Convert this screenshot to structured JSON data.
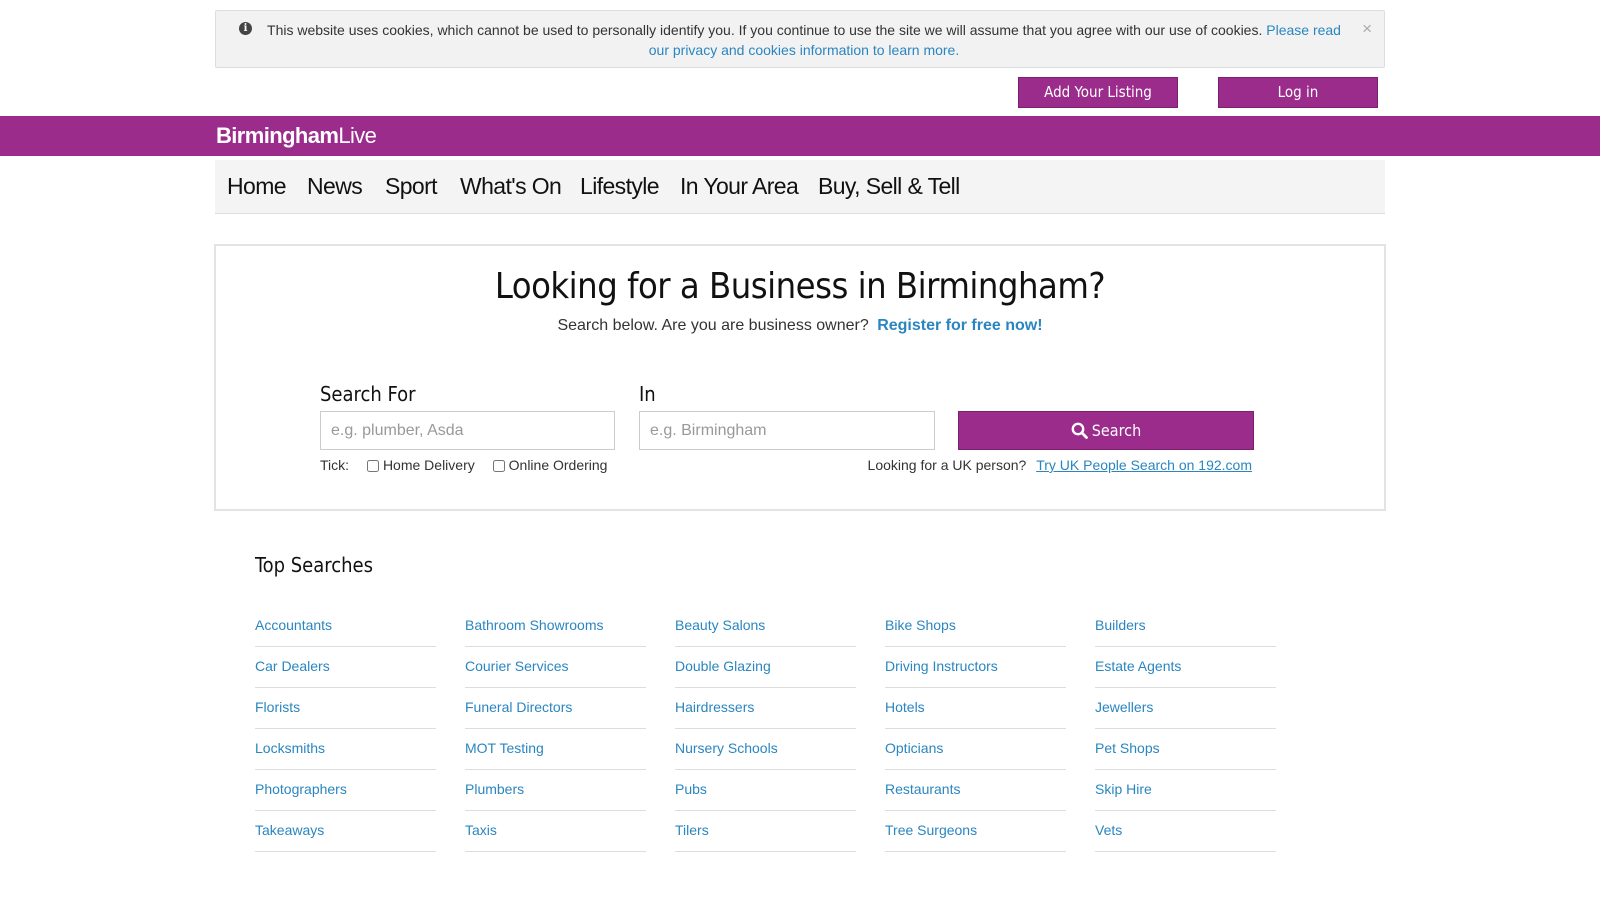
{
  "cookie_banner": {
    "message": "This website uses cookies, which cannot be used to personally identify you. If you continue to use the site we will assume that you agree with our use of cookies.",
    "link": "Please read our privacy and cookies information to learn more.",
    "close": "×"
  },
  "header": {
    "add_listing": "Add Your Listing",
    "login": "Log in"
  },
  "brand": {
    "logo_part1": "Birmingham",
    "logo_part2": "Live",
    "color": "#9b2c8c"
  },
  "nav": [
    "Home",
    "News",
    "Sport",
    "What's On",
    "Lifestyle",
    "In Your Area",
    "Buy, Sell & Tell"
  ],
  "search": {
    "title": "Looking for a Business in Birmingham?",
    "subtitle": "Search below. Are you are business owner?",
    "register": "Register for free now!",
    "what_label": "Search For",
    "what_placeholder": "e.g. plumber, Asda",
    "where_label": "In",
    "where_placeholder": "e.g. Birmingham",
    "button": "Search",
    "tick_label": "Tick:",
    "option_delivery": "Home Delivery",
    "option_ordering": "Online Ordering",
    "person_prompt": "Looking for a UK person?",
    "person_link": "Try UK People Search on 192.com"
  },
  "top_searches": {
    "title": "Top Searches",
    "items": [
      "Accountants",
      "Bathroom Showrooms",
      "Beauty Salons",
      "Bike Shops",
      "Builders",
      "Car Dealers",
      "Courier Services",
      "Double Glazing",
      "Driving Instructors",
      "Estate Agents",
      "Florists",
      "Funeral Directors",
      "Hairdressers",
      "Hotels",
      "Jewellers",
      "Locksmiths",
      "MOT Testing",
      "Nursery Schools",
      "Opticians",
      "Pet Shops",
      "Photographers",
      "Plumbers",
      "Pubs",
      "Restaurants",
      "Skip Hire",
      "Takeaways",
      "Taxis",
      "Tilers",
      "Tree Surgeons",
      "Vets"
    ]
  }
}
